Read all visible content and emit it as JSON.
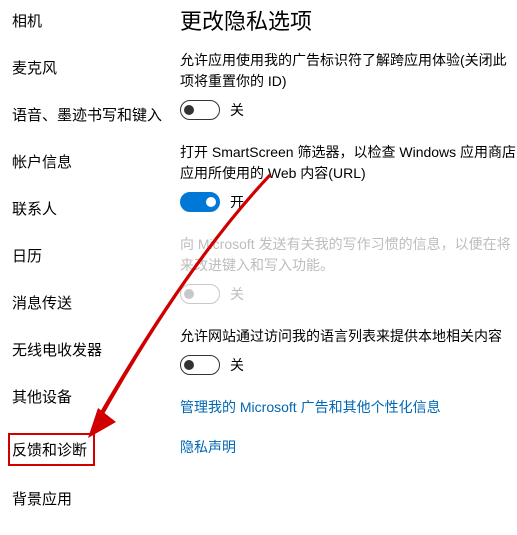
{
  "sidebar": {
    "items": [
      {
        "label": "相机"
      },
      {
        "label": "麦克风"
      },
      {
        "label": "语音、墨迹书写和键入"
      },
      {
        "label": "帐户信息"
      },
      {
        "label": "联系人"
      },
      {
        "label": "日历"
      },
      {
        "label": "消息传送"
      },
      {
        "label": "无线电收发器"
      },
      {
        "label": "其他设备"
      },
      {
        "label": "反馈和诊断"
      },
      {
        "label": "背景应用"
      }
    ]
  },
  "main": {
    "title": "更改隐私选项",
    "settings": [
      {
        "text": "允许应用使用我的广告标识符了解跨应用体验(关闭此项将重置你的 ID)",
        "state": "off",
        "state_label": "关"
      },
      {
        "text": "打开 SmartScreen 筛选器，以检查 Windows 应用商店应用所使用的 Web 内容(URL)",
        "state": "on",
        "state_label": "开"
      },
      {
        "text": "向 Microsoft 发送有关我的写作习惯的信息，以便在将来改进键入和写入功能。",
        "state": "disabled",
        "state_label": "关"
      },
      {
        "text": "允许网站通过访问我的语言列表来提供本地相关内容",
        "state": "off",
        "state_label": "关"
      }
    ],
    "links": [
      "管理我的 Microsoft 广告和其他个性化信息",
      "隐私声明"
    ]
  }
}
